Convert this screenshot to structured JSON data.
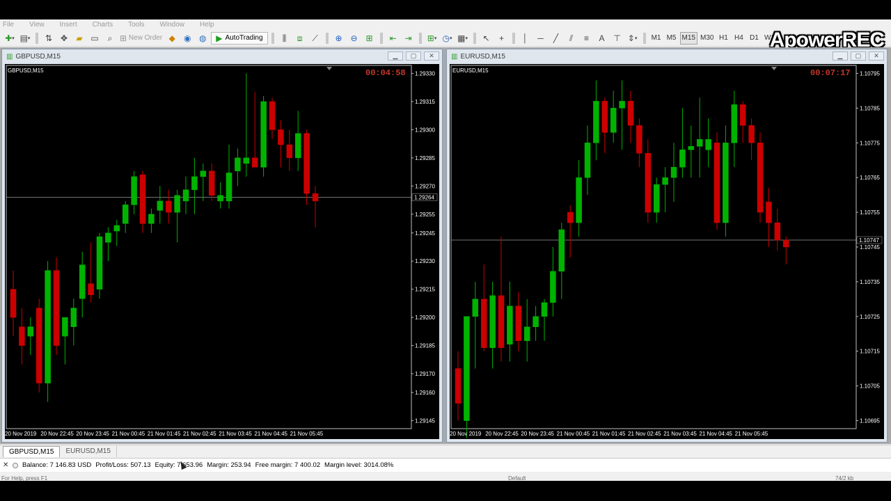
{
  "menu": [
    "File",
    "View",
    "Insert",
    "Charts",
    "Tools",
    "Window",
    "Help"
  ],
  "toolbar": {
    "new_order": "New Order",
    "autotrading": "AutoTrading",
    "timeframes": [
      "M1",
      "M5",
      "M15",
      "M30",
      "H1",
      "H4",
      "D1",
      "W1"
    ]
  },
  "watermark": "ApowerREC",
  "charts": [
    {
      "window_title": "GBPUSD,M15",
      "symbol_label": "GBPUSD,M15",
      "timer": "00:04:58",
      "price_ticks": [
        "1.29330",
        "1.29315",
        "1.29300",
        "1.29285",
        "1.29270",
        "1.29255",
        "1.29245",
        "1.29230",
        "1.29215",
        "1.29200",
        "1.29185",
        "1.29170",
        "1.29160",
        "1.29145"
      ],
      "current_price": "1.29264",
      "time_labels": [
        "20 Nov 2019",
        "20 Nov 22:45",
        "20 Nov 23:45",
        "21 Nov 00:45",
        "21 Nov 01:45",
        "21 Nov 02:45",
        "21 Nov 03:45",
        "21 Nov 04:45",
        "21 Nov 05:45"
      ]
    },
    {
      "window_title": "EURUSD,M15",
      "symbol_label": "EURUSD,M15",
      "timer": "00:07:17",
      "price_ticks": [
        "1.10795",
        "1.10785",
        "1.10775",
        "1.10765",
        "1.10755",
        "1.10745",
        "1.10735",
        "1.10725",
        "1.10715",
        "1.10705",
        "1.10695"
      ],
      "current_price": "1.10747",
      "time_labels": [
        "20 Nov 2019",
        "20 Nov 22:45",
        "20 Nov 23:45",
        "21 Nov 00:45",
        "21 Nov 01:45",
        "21 Nov 02:45",
        "21 Nov 03:45",
        "21 Nov 04:45",
        "21 Nov 05:45"
      ]
    }
  ],
  "chart_data": [
    {
      "type": "candlestick",
      "title": "GBPUSD,M15",
      "candles": [
        {
          "o": 1.29215,
          "h": 1.29225,
          "l": 1.2919,
          "c": 1.292,
          "d": "down"
        },
        {
          "o": 1.29195,
          "h": 1.29205,
          "l": 1.29175,
          "c": 1.29185,
          "d": "down"
        },
        {
          "o": 1.29195,
          "h": 1.292,
          "l": 1.2918,
          "c": 1.2919,
          "d": "up"
        },
        {
          "o": 1.29205,
          "h": 1.2921,
          "l": 1.2916,
          "c": 1.29165,
          "d": "down"
        },
        {
          "o": 1.29165,
          "h": 1.2923,
          "l": 1.29155,
          "c": 1.29225,
          "d": "up"
        },
        {
          "o": 1.29225,
          "h": 1.29232,
          "l": 1.2918,
          "c": 1.29185,
          "d": "down"
        },
        {
          "o": 1.2919,
          "h": 1.292,
          "l": 1.29175,
          "c": 1.292,
          "d": "up"
        },
        {
          "o": 1.29205,
          "h": 1.2921,
          "l": 1.29185,
          "c": 1.29195,
          "d": "up"
        },
        {
          "o": 1.2921,
          "h": 1.29235,
          "l": 1.292,
          "c": 1.29228,
          "d": "up"
        },
        {
          "o": 1.29218,
          "h": 1.2924,
          "l": 1.29208,
          "c": 1.29212,
          "d": "down"
        },
        {
          "o": 1.29215,
          "h": 1.29245,
          "l": 1.2921,
          "c": 1.29243,
          "d": "up"
        },
        {
          "o": 1.2924,
          "h": 1.29248,
          "l": 1.2923,
          "c": 1.29245,
          "d": "up"
        },
        {
          "o": 1.29246,
          "h": 1.29252,
          "l": 1.29238,
          "c": 1.29249,
          "d": "up"
        },
        {
          "o": 1.2925,
          "h": 1.29262,
          "l": 1.29245,
          "c": 1.2926,
          "d": "up"
        },
        {
          "o": 1.2926,
          "h": 1.29278,
          "l": 1.29255,
          "c": 1.29275,
          "d": "up"
        },
        {
          "o": 1.29276,
          "h": 1.29278,
          "l": 1.29245,
          "c": 1.2925,
          "d": "down"
        },
        {
          "o": 1.2925,
          "h": 1.29258,
          "l": 1.29245,
          "c": 1.29255,
          "d": "up"
        },
        {
          "o": 1.29257,
          "h": 1.2927,
          "l": 1.2925,
          "c": 1.29262,
          "d": "up"
        },
        {
          "o": 1.29262,
          "h": 1.29268,
          "l": 1.2925,
          "c": 1.29256,
          "d": "down"
        },
        {
          "o": 1.29256,
          "h": 1.29268,
          "l": 1.2924,
          "c": 1.29265,
          "d": "up"
        },
        {
          "o": 1.29262,
          "h": 1.29275,
          "l": 1.29255,
          "c": 1.29268,
          "d": "up"
        },
        {
          "o": 1.29268,
          "h": 1.29285,
          "l": 1.29255,
          "c": 1.29275,
          "d": "up"
        },
        {
          "o": 1.29275,
          "h": 1.29282,
          "l": 1.29262,
          "c": 1.29278,
          "d": "up"
        },
        {
          "o": 1.29278,
          "h": 1.29282,
          "l": 1.29262,
          "c": 1.29265,
          "d": "down"
        },
        {
          "o": 1.29265,
          "h": 1.29272,
          "l": 1.29258,
          "c": 1.29262,
          "d": "up"
        },
        {
          "o": 1.29262,
          "h": 1.29292,
          "l": 1.29258,
          "c": 1.29277,
          "d": "up"
        },
        {
          "o": 1.29278,
          "h": 1.2929,
          "l": 1.2927,
          "c": 1.29285,
          "d": "up"
        },
        {
          "o": 1.29282,
          "h": 1.2933,
          "l": 1.29275,
          "c": 1.29285,
          "d": "up"
        },
        {
          "o": 1.29285,
          "h": 1.2932,
          "l": 1.2928,
          "c": 1.2928,
          "d": "down"
        },
        {
          "o": 1.2928,
          "h": 1.29318,
          "l": 1.29275,
          "c": 1.29315,
          "d": "up"
        },
        {
          "o": 1.29315,
          "h": 1.29317,
          "l": 1.29295,
          "c": 1.293,
          "d": "down"
        },
        {
          "o": 1.293,
          "h": 1.29305,
          "l": 1.2928,
          "c": 1.29292,
          "d": "down"
        },
        {
          "o": 1.29292,
          "h": 1.293,
          "l": 1.29278,
          "c": 1.29285,
          "d": "down"
        },
        {
          "o": 1.29285,
          "h": 1.2931,
          "l": 1.29278,
          "c": 1.29298,
          "d": "up"
        },
        {
          "o": 1.29298,
          "h": 1.293,
          "l": 1.2926,
          "c": 1.29266,
          "d": "down"
        },
        {
          "o": 1.29266,
          "h": 1.2927,
          "l": 1.29248,
          "c": 1.29262,
          "d": "down"
        }
      ]
    },
    {
      "type": "candlestick",
      "title": "EURUSD,M15",
      "candles": [
        {
          "o": 1.1071,
          "h": 1.10715,
          "l": 1.10695,
          "c": 1.107,
          "d": "down"
        },
        {
          "o": 1.10695,
          "h": 1.10725,
          "l": 1.1069,
          "c": 1.10725,
          "d": "up"
        },
        {
          "o": 1.10725,
          "h": 1.10735,
          "l": 1.1071,
          "c": 1.1073,
          "d": "up"
        },
        {
          "o": 1.1073,
          "h": 1.1074,
          "l": 1.10715,
          "c": 1.10716,
          "d": "down"
        },
        {
          "o": 1.10716,
          "h": 1.10735,
          "l": 1.1071,
          "c": 1.10731,
          "d": "up"
        },
        {
          "o": 1.10731,
          "h": 1.10748,
          "l": 1.10712,
          "c": 1.10716,
          "d": "down"
        },
        {
          "o": 1.10717,
          "h": 1.10735,
          "l": 1.10712,
          "c": 1.10728,
          "d": "up"
        },
        {
          "o": 1.10728,
          "h": 1.10732,
          "l": 1.10715,
          "c": 1.10718,
          "d": "down"
        },
        {
          "o": 1.10718,
          "h": 1.1073,
          "l": 1.10712,
          "c": 1.10722,
          "d": "up"
        },
        {
          "o": 1.10722,
          "h": 1.10728,
          "l": 1.10718,
          "c": 1.10725,
          "d": "up"
        },
        {
          "o": 1.10725,
          "h": 1.1073,
          "l": 1.10718,
          "c": 1.10729,
          "d": "up"
        },
        {
          "o": 1.10729,
          "h": 1.10745,
          "l": 1.10725,
          "c": 1.10738,
          "d": "up"
        },
        {
          "o": 1.10738,
          "h": 1.10752,
          "l": 1.1073,
          "c": 1.1075,
          "d": "up"
        },
        {
          "o": 1.10755,
          "h": 1.10757,
          "l": 1.10742,
          "c": 1.10752,
          "d": "down"
        },
        {
          "o": 1.10752,
          "h": 1.1077,
          "l": 1.10748,
          "c": 1.10765,
          "d": "up"
        },
        {
          "o": 1.10765,
          "h": 1.1078,
          "l": 1.1076,
          "c": 1.10775,
          "d": "up"
        },
        {
          "o": 1.10775,
          "h": 1.10793,
          "l": 1.1077,
          "c": 1.10787,
          "d": "up"
        },
        {
          "o": 1.10787,
          "h": 1.10788,
          "l": 1.10772,
          "c": 1.10778,
          "d": "down"
        },
        {
          "o": 1.10778,
          "h": 1.1079,
          "l": 1.10775,
          "c": 1.10785,
          "d": "up"
        },
        {
          "o": 1.10785,
          "h": 1.10793,
          "l": 1.10773,
          "c": 1.10787,
          "d": "up"
        },
        {
          "o": 1.10787,
          "h": 1.1079,
          "l": 1.10775,
          "c": 1.1078,
          "d": "down"
        },
        {
          "o": 1.1078,
          "h": 1.10782,
          "l": 1.10768,
          "c": 1.10772,
          "d": "down"
        },
        {
          "o": 1.10772,
          "h": 1.10776,
          "l": 1.10752,
          "c": 1.10755,
          "d": "down"
        },
        {
          "o": 1.10755,
          "h": 1.10765,
          "l": 1.10752,
          "c": 1.10763,
          "d": "up"
        },
        {
          "o": 1.10763,
          "h": 1.10768,
          "l": 1.10755,
          "c": 1.10765,
          "d": "up"
        },
        {
          "o": 1.10765,
          "h": 1.10775,
          "l": 1.10758,
          "c": 1.10768,
          "d": "up"
        },
        {
          "o": 1.10768,
          "h": 1.10785,
          "l": 1.10765,
          "c": 1.10773,
          "d": "up"
        },
        {
          "o": 1.10773,
          "h": 1.1078,
          "l": 1.10765,
          "c": 1.10774,
          "d": "up"
        },
        {
          "o": 1.10774,
          "h": 1.10788,
          "l": 1.10765,
          "c": 1.10776,
          "d": "up"
        },
        {
          "o": 1.10776,
          "h": 1.10782,
          "l": 1.10768,
          "c": 1.10773,
          "d": "up"
        },
        {
          "o": 1.10775,
          "h": 1.10778,
          "l": 1.1075,
          "c": 1.10752,
          "d": "down"
        },
        {
          "o": 1.10752,
          "h": 1.1078,
          "l": 1.10748,
          "c": 1.10775,
          "d": "up"
        },
        {
          "o": 1.10775,
          "h": 1.1079,
          "l": 1.10768,
          "c": 1.10786,
          "d": "up"
        },
        {
          "o": 1.10786,
          "h": 1.10787,
          "l": 1.10775,
          "c": 1.1078,
          "d": "down"
        },
        {
          "o": 1.1078,
          "h": 1.10782,
          "l": 1.1077,
          "c": 1.10775,
          "d": "down"
        },
        {
          "o": 1.10775,
          "h": 1.10778,
          "l": 1.10752,
          "c": 1.10755,
          "d": "down"
        },
        {
          "o": 1.10758,
          "h": 1.10762,
          "l": 1.10745,
          "c": 1.10752,
          "d": "down"
        },
        {
          "o": 1.10752,
          "h": 1.10756,
          "l": 1.10744,
          "c": 1.10747,
          "d": "down"
        },
        {
          "o": 1.10747,
          "h": 1.10748,
          "l": 1.1074,
          "c": 1.10745,
          "d": "down"
        }
      ]
    }
  ],
  "tabs": [
    "GBPUSD,M15",
    "EURUSD,M15"
  ],
  "account": {
    "balance": "Balance: 7 146.83 USD",
    "profit": "Profit/Loss: 507.13",
    "equity": "Equity: 7 653.96",
    "margin": "Margin: 253.94",
    "free_margin": "Free margin: 7 400.02",
    "margin_level": "Margin level: 3014.08%"
  },
  "bottom_status": {
    "help": "For Help, press F1",
    "profile": "Default",
    "traffic": "74/2 kb"
  },
  "colors": {
    "bull": "#00b300",
    "bear": "#cc0000",
    "grid": "#c0c0c0",
    "timer": "#c0392b"
  }
}
